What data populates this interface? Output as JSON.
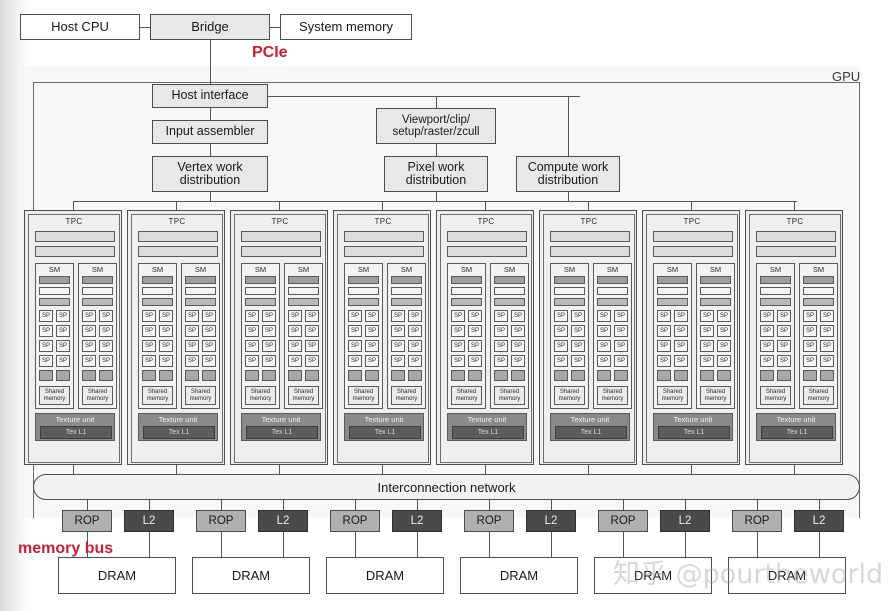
{
  "header": {
    "host_cpu": "Host CPU",
    "bridge": "Bridge",
    "system_memory": "System memory",
    "pcie_label": "PCIe",
    "pcie_color": "#cc1f33"
  },
  "gpu": {
    "label": "GPU",
    "host_interface": "Host interface",
    "input_assembler": "Input assembler",
    "vertex_work_distribution": "Vertex work\ndistribution",
    "viewport_clip": "Viewport/clip/\nsetup/raster/zcull",
    "pixel_work_distribution": "Pixel work\ndistribution",
    "compute_work_distribution": "Compute work\ndistribution",
    "interconnection_network": "Interconnection network"
  },
  "tpc": {
    "count": 8,
    "title": "TPC",
    "sm_title": "SM",
    "sm_count_per_tpc": 2,
    "sp_label": "SP",
    "sp_rows": 4,
    "sp_cols": 2,
    "sfu_count": 2,
    "shared_memory": "Shared\nmemory",
    "texture_unit": "Texture unit",
    "tex_l1": "Tex L1"
  },
  "memory": {
    "rop_label": "ROP",
    "l2_label": "L2",
    "dram_label": "DRAM",
    "partition_count": 6,
    "memory_bus_label": "memory bus",
    "memory_bus_color": "#cc1f33"
  },
  "watermark": {
    "text": "知乎 @pourtheworld"
  }
}
